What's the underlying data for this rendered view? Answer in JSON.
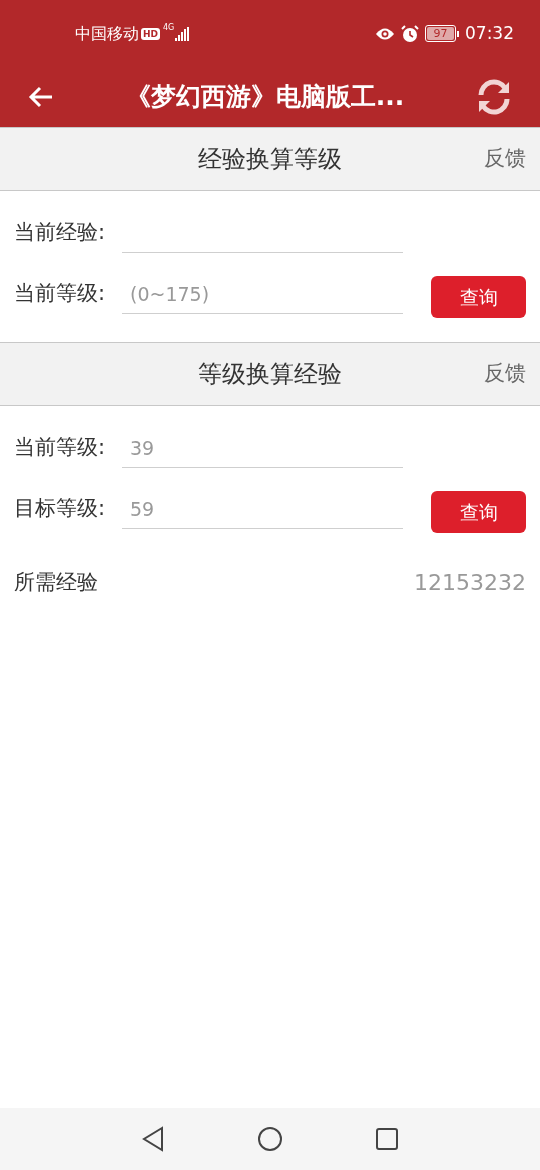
{
  "status_bar": {
    "carrier": "中国移动",
    "hd": "HD",
    "network": "4G",
    "battery": "97",
    "time": "07:32"
  },
  "app_bar": {
    "title": "《梦幻西游》电脑版工..."
  },
  "sections": [
    {
      "title": "经验换算等级",
      "feedback": "反馈",
      "fields": [
        {
          "label": "当前经验:"
        },
        {
          "label": "当前等级:",
          "placeholder": "(0~175)"
        }
      ],
      "button": "查询"
    },
    {
      "title": "等级换算经验",
      "feedback": "反馈",
      "fields": [
        {
          "label": "当前等级:",
          "placeholder": "39"
        },
        {
          "label": "目标等级:",
          "placeholder": "59"
        }
      ],
      "button": "查询",
      "result": {
        "label": "所需经验",
        "value": "12153232"
      }
    }
  ]
}
